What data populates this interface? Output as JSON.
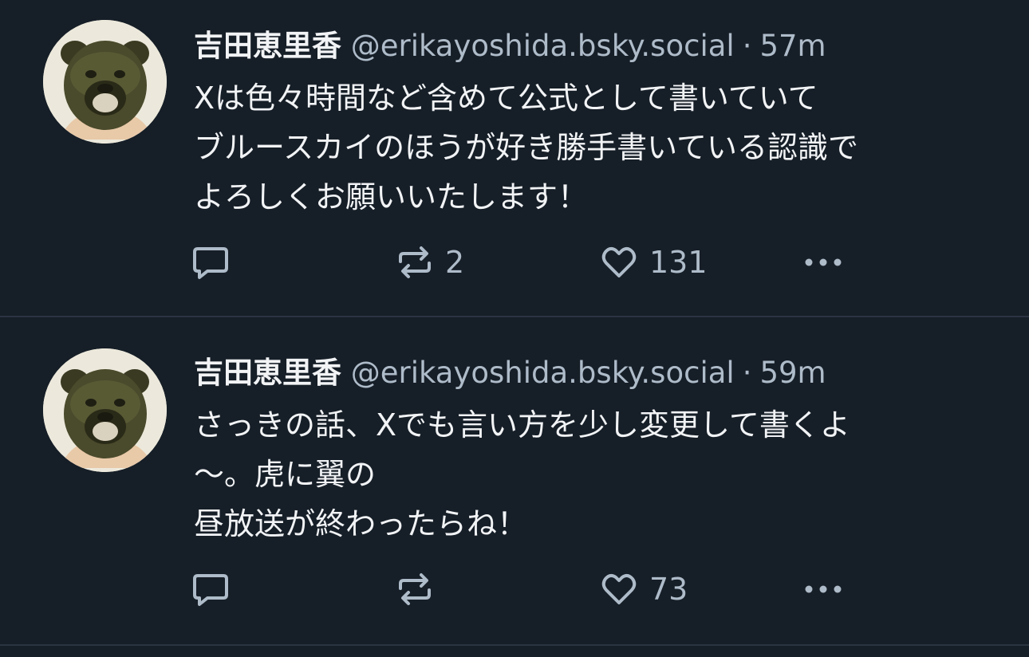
{
  "posts": [
    {
      "display_name": "吉田恵里香",
      "handle": "@erikayoshida.bsky.social",
      "separator": "·",
      "time": "57m",
      "text_lines": [
        "Xは色々時間など含めて公式として書いていて",
        "ブルースカイのほうが好き勝手書いている認識で",
        "よろしくお願いいたします！"
      ],
      "reply_count": "",
      "repost_count": "2",
      "like_count": "131"
    },
    {
      "display_name": "吉田恵里香",
      "handle": "@erikayoshida.bsky.social",
      "separator": "·",
      "time": "59m",
      "text_lines": [
        "さっきの話、Xでも言い方を少し変更して書くよ",
        "〜。虎に翼の",
        "昼放送が終わったらね！"
      ],
      "reply_count": "",
      "repost_count": "",
      "like_count": "73"
    }
  ],
  "icons": {
    "reply": "reply-icon",
    "repost": "repost-icon",
    "like": "heart-icon",
    "more": "more-icon"
  },
  "colors": {
    "background": "#161e27",
    "text": "#f1f3f5",
    "muted": "#aebbc9",
    "divider": "#2a3441"
  }
}
